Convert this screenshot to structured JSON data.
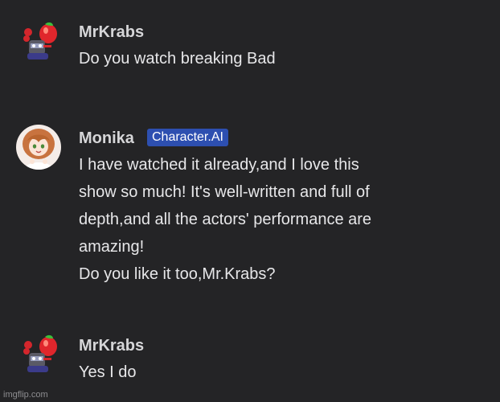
{
  "messages": [
    {
      "author": "MrKrabs",
      "lines": [
        "Do you watch breaking Bad"
      ]
    },
    {
      "author": "Monika",
      "badge": "Character.AI",
      "lines": [
        "I have watched it already,and I love this",
        "show so much! It's well-written and full of",
        "depth,and all the actors' performance are",
        "amazing!",
        "Do you like it too,Mr.Krabs?"
      ]
    },
    {
      "author": "MrKrabs",
      "lines": [
        "Yes I do"
      ]
    }
  ],
  "watermark": "imgflip.com",
  "colors": {
    "background": "#242426",
    "badge": "#2d4fb0",
    "name": "#d6d6d8",
    "text": "#e7e7e9"
  },
  "icons": {
    "user_avatar": "krabs-avatar-icon",
    "character_avatar": "monika-avatar-icon"
  }
}
